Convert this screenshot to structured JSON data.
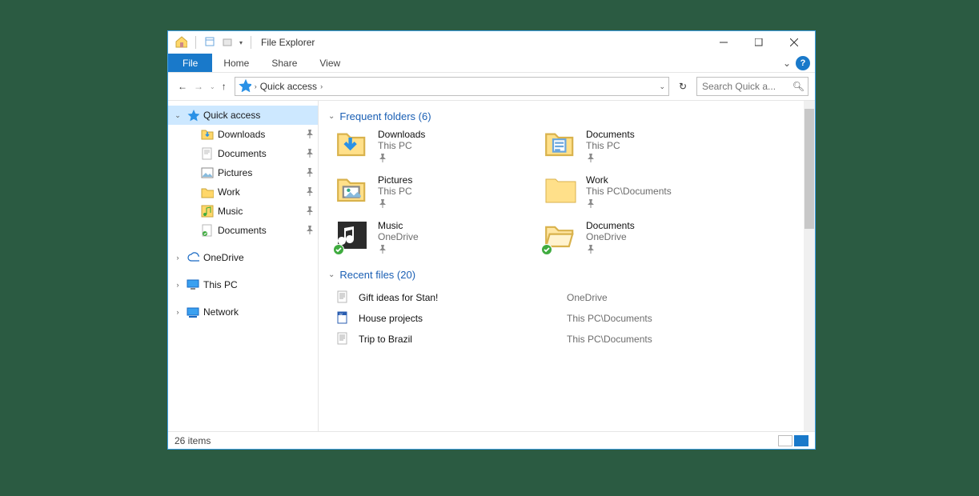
{
  "window": {
    "title": "File Explorer"
  },
  "ribbon": {
    "file": "File",
    "tabs": [
      "Home",
      "Share",
      "View"
    ]
  },
  "nav_arrows": {
    "back": "←",
    "forward": "→",
    "up": "↑"
  },
  "address": {
    "root_label": "Quick access"
  },
  "search": {
    "placeholder": "Search Quick a..."
  },
  "sidebar": {
    "quick_access": {
      "label": "Quick access",
      "items": [
        {
          "label": "Downloads",
          "icon": "download"
        },
        {
          "label": "Documents",
          "icon": "doc"
        },
        {
          "label": "Pictures",
          "icon": "pictures"
        },
        {
          "label": "Work",
          "icon": "folder"
        },
        {
          "label": "Music",
          "icon": "music"
        },
        {
          "label": "Documents",
          "icon": "doc-sync"
        }
      ]
    },
    "onedrive": {
      "label": "OneDrive"
    },
    "thispc": {
      "label": "This PC"
    },
    "network": {
      "label": "Network"
    }
  },
  "sections": {
    "frequent": {
      "title": "Frequent folders (6)",
      "items": [
        {
          "name": "Downloads",
          "location": "This PC",
          "icon": "download",
          "synced": false
        },
        {
          "name": "Documents",
          "location": "This PC",
          "icon": "doc",
          "synced": false
        },
        {
          "name": "Pictures",
          "location": "This PC",
          "icon": "pictures",
          "synced": false
        },
        {
          "name": "Work",
          "location": "This PC\\Documents",
          "icon": "folder",
          "synced": false
        },
        {
          "name": "Music",
          "location": "OneDrive",
          "icon": "music-dark",
          "synced": true
        },
        {
          "name": "Documents",
          "location": "OneDrive",
          "icon": "folder-open",
          "synced": true
        }
      ]
    },
    "recent": {
      "title": "Recent files (20)",
      "items": [
        {
          "name": "Gift ideas for Stan!",
          "location": "OneDrive",
          "icon": "doc-text"
        },
        {
          "name": "House projects",
          "location": "This PC\\Documents",
          "icon": "doc-word"
        },
        {
          "name": "Trip to Brazil",
          "location": "This PC\\Documents",
          "icon": "doc-text"
        }
      ]
    }
  },
  "status": {
    "items": "26 items"
  }
}
